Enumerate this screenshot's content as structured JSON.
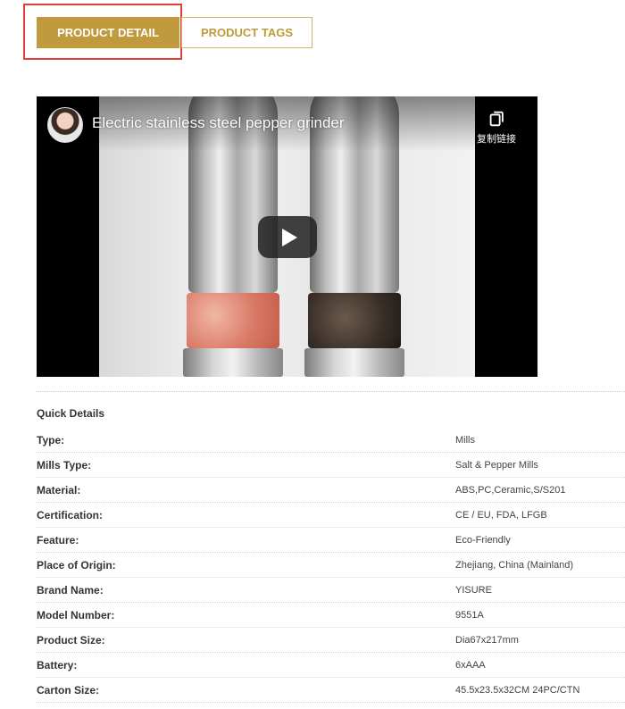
{
  "tabs": [
    {
      "label": "PRODUCT DETAIL",
      "active": true
    },
    {
      "label": "PRODUCT TAGS",
      "active": false
    }
  ],
  "video": {
    "title": "Electric stainless steel pepper grinder",
    "copy_link_label": "复制链接"
  },
  "quick_details": {
    "heading": "Quick Details",
    "rows": [
      {
        "label": "Type:",
        "value": "Mills"
      },
      {
        "label": "Mills Type:",
        "value": "Salt & Pepper Mills"
      },
      {
        "label": "Material:",
        "value": "ABS,PC,Ceramic,S/S201"
      },
      {
        "label": "Certification:",
        "value": "CE / EU, FDA, LFGB"
      },
      {
        "label": "Feature:",
        "value": "Eco-Friendly"
      },
      {
        "label": "Place of Origin:",
        "value": "Zhejiang, China (Mainland)"
      },
      {
        "label": "Brand Name:",
        "value": "YISURE"
      },
      {
        "label": "Model Number:",
        "value": "9551A"
      },
      {
        "label": "Product Size:",
        "value": "Dia67x217mm"
      },
      {
        "label": "Battery:",
        "value": "6xAAA"
      },
      {
        "label": "Carton Size:",
        "value": "45.5x23.5x32CM 24PC/CTN"
      }
    ]
  },
  "colors": {
    "accent": "#c09a3c",
    "highlight_border": "#e0403a"
  }
}
